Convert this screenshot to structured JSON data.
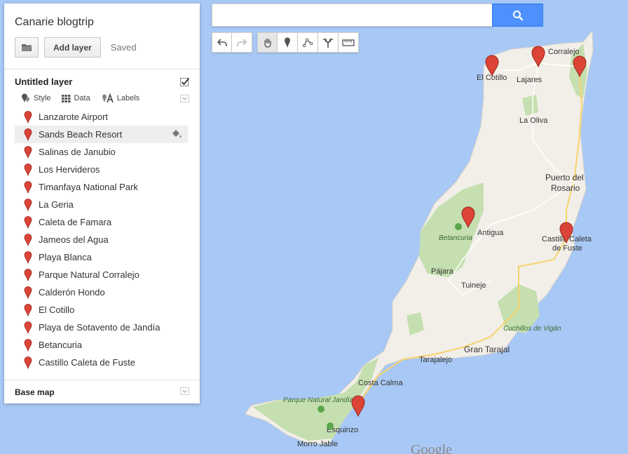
{
  "map": {
    "title": "Canarie blogtrip",
    "add_layer_label": "Add layer",
    "status": "Saved",
    "search_value": "",
    "search_placeholder": "",
    "google_logo": "Google"
  },
  "layer": {
    "title": "Untitled layer",
    "checked": true,
    "tools": {
      "style": "Style",
      "data": "Data",
      "labels": "Labels"
    },
    "places": [
      "Lanzarote Airport",
      "Sands Beach Resort",
      "Salinas de Janubio",
      "Los Hervideros",
      "Timanfaya National Park",
      "La Geria",
      "Caleta de Famara",
      "Jameos del Agua",
      "Playa Blanca",
      "Parque Natural Corralejo",
      "Calderón Hondo",
      "El Cotillo",
      "Playa de Sotavento de Jandía",
      "Betancuria",
      "Castillo Caleta de Fuste"
    ],
    "selected_index": 1
  },
  "base_map": {
    "title": "Base map"
  },
  "map_labels": {
    "corralejo": "Corralejo",
    "el_cotillo": "El Cotillo",
    "lajares": "Lajares",
    "la_oliva": "La Oliva",
    "puerto1": "Puerto del",
    "puerto2": "Rosario",
    "antigua": "Antigua",
    "betancuria": "Betancuria",
    "castillo1": "Castillo Caleta",
    "castillo2": "de Fuste",
    "pajara": "Pájara",
    "tuineje": "Tuineje",
    "cuchillos": "Cuchillos de Vigán",
    "gran_tarajal": "Gran Tarajal",
    "tarajalejo": "Tarajalejo",
    "costa_calma": "Costa Calma",
    "parque_jandia": "Parque Natural Jandía",
    "esquinzo": "Esquinzo",
    "morro_jable": "Morro Jable"
  },
  "colors": {
    "water": "#a8c8f5",
    "land": "#f2efe9",
    "park": "#c5dfb0",
    "road": "#f7d36b",
    "marker": "#db4437",
    "accent": "#4d90fe"
  },
  "toolbar_icons": [
    "undo-icon",
    "redo-icon",
    "hand-icon",
    "marker-icon",
    "line-icon",
    "directions-icon",
    "ruler-icon"
  ]
}
